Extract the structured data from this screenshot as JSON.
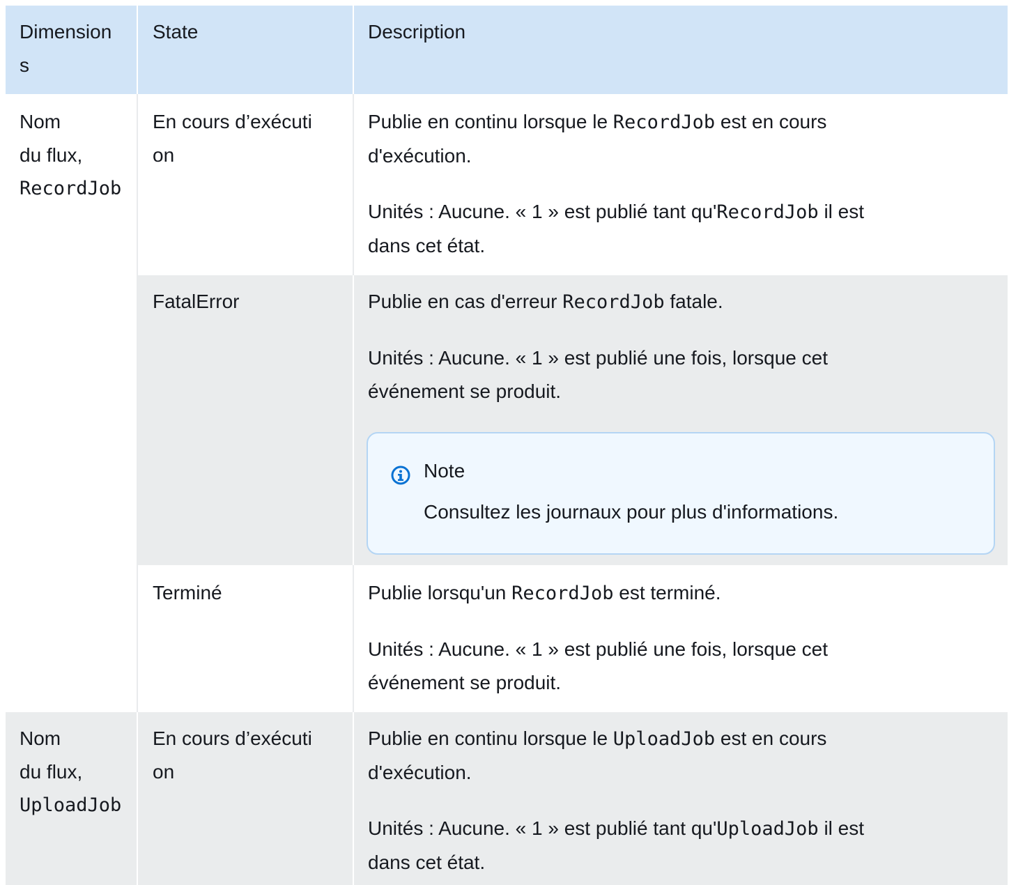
{
  "header": {
    "col1_line1": "Dimension",
    "col1_line2": "s",
    "col2": "State",
    "col3": "Description"
  },
  "rows": [
    {
      "dimension_line1": "Nom",
      "dimension_line2": "du flux,",
      "dimension_code": "RecordJob",
      "states": [
        {
          "state_line1": "En cours d’exécuti",
          "state_line2": "on",
          "desc1_pre": "Publie en continu lorsque le ",
          "desc1_code": "RecordJob",
          "desc1_post": " est en cours",
          "desc1_line2": "d'exécution.",
          "desc2_pre": "Unités : Aucune. « 1 » est publié tant qu'",
          "desc2_code": "RecordJob",
          "desc2_post": " il est",
          "desc2_line2": "dans cet état."
        },
        {
          "state_line1": "FatalError",
          "desc1_pre": "Publie en cas d'erreur ",
          "desc1_code": "RecordJob",
          "desc1_post": " fatale.",
          "desc2_line1": "Unités : Aucune. « 1 » est publié une fois, lorsque cet",
          "desc2_line2": "événement se produit.",
          "note_title": "Note",
          "note_text": "Consultez les journaux pour plus d'informations."
        },
        {
          "state_line1": "Terminé",
          "desc1_pre": "Publie lorsqu'un ",
          "desc1_code": "RecordJob",
          "desc1_post": " est terminé.",
          "desc2_line1": "Unités : Aucune. « 1 » est publié une fois, lorsque cet",
          "desc2_line2": "événement se produit."
        }
      ]
    },
    {
      "dimension_line1": "Nom",
      "dimension_line2": "du flux,",
      "dimension_code": "UploadJob",
      "states": [
        {
          "state_line1": "En cours d’exécuti",
          "state_line2": "on",
          "desc1_pre": "Publie en continu lorsque le ",
          "desc1_code": "UploadJob",
          "desc1_post": " est en cours",
          "desc1_line2": "d'exécution.",
          "desc2_pre": "Unités : Aucune. « 1 » est publié tant qu'",
          "desc2_code": "UploadJob",
          "desc2_post": " il est",
          "desc2_line2": "dans cet état."
        }
      ]
    }
  ],
  "colors": {
    "header_bg": "#d1e4f7",
    "alt_row_bg": "#eaeced",
    "note_bg": "#f0f8ff",
    "note_border": "#b4d5f4",
    "info_icon": "#0972d3"
  },
  "icons": {
    "note": "info-circle-icon"
  }
}
